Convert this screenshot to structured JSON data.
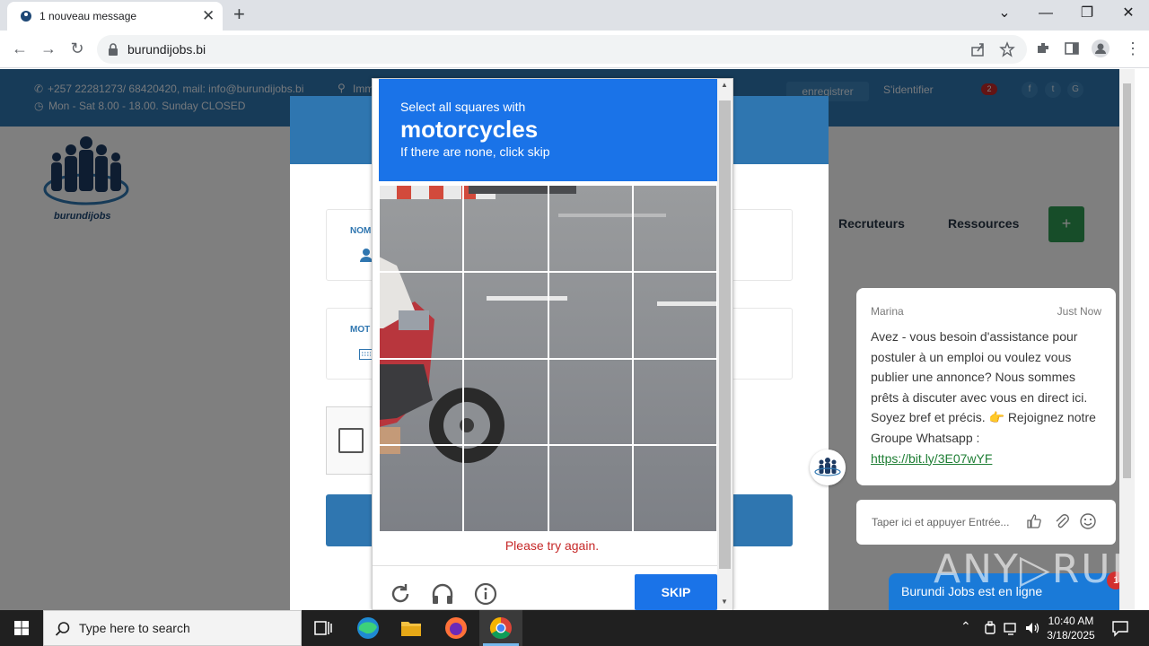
{
  "browser": {
    "tab_title": "1 nouveau message",
    "tab_close": "✕",
    "new_tab": "+",
    "url": "burundijobs.bi",
    "window_controls": [
      "⌄",
      "—",
      "❐",
      "✕"
    ]
  },
  "site": {
    "contact_line": "+257 22281273/ 68420420, mail: info@burundijobs.bi",
    "address_fragment": "Imm",
    "hours_line": "Mon - Sat 8.00 - 18.00. Sunday CLOSED",
    "register_label": "enregistrer",
    "login_label": "S'identifier",
    "notif_count": "2",
    "social": [
      "f",
      "t",
      "G"
    ],
    "logo_text": "burundijobs",
    "nav": [
      "Recruteurs",
      "Ressources"
    ],
    "add_icon": "+",
    "form": {
      "name_label": "NOM",
      "password_label": "MOT"
    }
  },
  "captcha": {
    "instruction_line1": "Select all squares with",
    "target_object": "motorcycles",
    "instruction_line3": "If there are none, click skip",
    "error": "Please try again.",
    "skip_label": "SKIP",
    "tiles": [
      {
        "selected": false
      },
      {
        "selected": false
      },
      {
        "selected": false
      },
      {
        "selected": false
      },
      {
        "selected": false
      },
      {
        "selected": false
      },
      {
        "selected": false
      },
      {
        "selected": false
      },
      {
        "selected": false
      },
      {
        "selected": false
      },
      {
        "selected": false
      },
      {
        "selected": false
      },
      {
        "selected": false
      },
      {
        "selected": false
      },
      {
        "selected": false
      },
      {
        "selected": false
      }
    ]
  },
  "chat": {
    "agent": "Marina",
    "time": "Just Now",
    "message": "Avez - vous besoin d'assistance pour postuler à un emploi ou voulez vous publier une annonce? Nous sommes prêts à discuter avec vous en direct ici. Soyez bref et précis. 👉 Rejoignez notre Groupe Whatsapp :",
    "link": "https://bit.ly/3E07wYF",
    "input_placeholder": "Taper ici et appuyer Entrée...",
    "online_label": "Burundi Jobs est en ligne",
    "unread_count": "1"
  },
  "watermark": "ANY▷RUN",
  "taskbar": {
    "search_placeholder": "Type here to search",
    "time": "10:40 AM",
    "date": "3/18/2025"
  },
  "colors": {
    "site_blue": "#2f76b0",
    "captcha_blue": "#1a73e8",
    "error_red": "#c62828",
    "add_green": "#2e9a52"
  }
}
